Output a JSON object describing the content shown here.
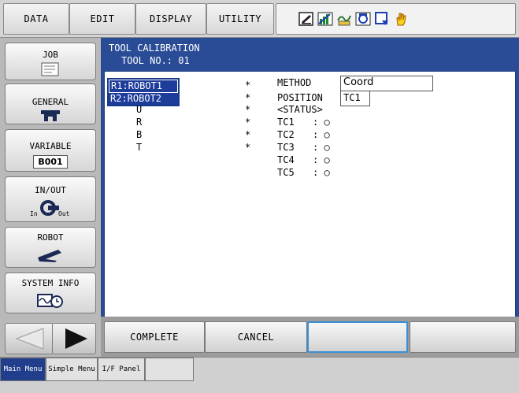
{
  "topbar": {
    "menus": [
      "DATA",
      "EDIT",
      "DISPLAY",
      "UTILITY"
    ],
    "status_icons": [
      "edit-mode-icon",
      "cycle-icon",
      "servo-icon",
      "teach-icon",
      "play-icon",
      "hand-icon"
    ]
  },
  "leftnav": {
    "items": [
      {
        "label": "JOB",
        "icon": "job-icon"
      },
      {
        "label": "GENERAL",
        "icon": "general-icon"
      },
      {
        "label": "VARIABLE",
        "icon": "variable-icon",
        "badge": "B001"
      },
      {
        "label": "IN/OUT",
        "icon": "inout-icon",
        "in": "In",
        "out": "Out"
      },
      {
        "label": "ROBOT",
        "icon": "robot-icon"
      },
      {
        "label": "SYSTEM INFO",
        "icon": "system-info-icon"
      }
    ]
  },
  "main": {
    "title": "TOOL CALIBRATION",
    "tool_no_label": "TOOL NO.: 01",
    "robots": [
      "R1:ROBOT1",
      "R2:ROBOT2"
    ],
    "axes": [
      {
        "axis": "U",
        "value": "*"
      },
      {
        "axis": "R",
        "value": "*"
      },
      {
        "axis": "B",
        "value": "*"
      },
      {
        "axis": "T",
        "value": "*"
      }
    ],
    "first_values": [
      "*",
      "*"
    ],
    "method_label": "METHOD",
    "method_value": "Coord",
    "position_label": "POSITION",
    "position_value": "TC1",
    "status_label": "<STATUS>",
    "status": [
      {
        "label": "TC1",
        "value": ": ○"
      },
      {
        "label": "TC2",
        "value": ": ○"
      },
      {
        "label": "TC3",
        "value": ": ○"
      },
      {
        "label": "TC4",
        "value": ": ○"
      },
      {
        "label": "TC5",
        "value": ": ○"
      }
    ]
  },
  "cmdbar": {
    "buttons": [
      "COMPLETE",
      "CANCEL",
      "",
      ""
    ]
  },
  "tabbar": {
    "tabs": [
      "Main Menu",
      "Simple Menu",
      "I/F Panel"
    ]
  }
}
